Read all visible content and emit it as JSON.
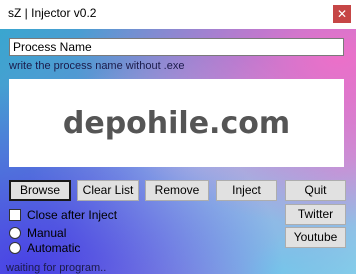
{
  "window": {
    "title": "sZ | Injector v0.2",
    "close_glyph": "✕"
  },
  "process": {
    "value": "Process Name",
    "hint": "write the process name without .exe"
  },
  "banner": {
    "text": "depohile.com"
  },
  "buttons": {
    "browse": "Browse",
    "clear_list": "Clear List",
    "remove": "Remove",
    "inject": "Inject",
    "quit": "Quit",
    "twitter": "Twitter",
    "youtube": "Youtube"
  },
  "options": {
    "close_after_inject": "Close after Inject",
    "manual": "Manual",
    "automatic": "Automatic"
  },
  "status": "waiting for program.."
}
